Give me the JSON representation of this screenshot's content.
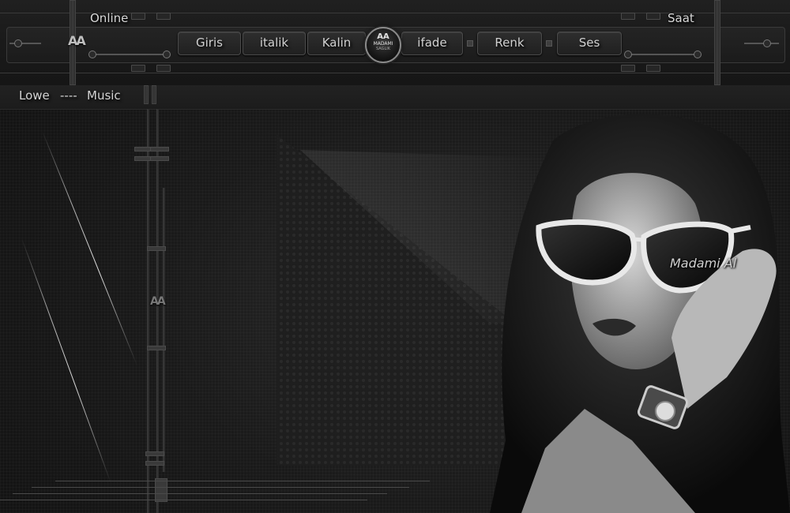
{
  "header": {
    "online_label": "Online",
    "clock_label": "Saat",
    "logo_text": "AA",
    "nav": [
      {
        "key": "giris",
        "label": "Giris"
      },
      {
        "key": "italik",
        "label": "italik"
      },
      {
        "key": "kalin",
        "label": "Kalin"
      },
      {
        "key": "ifade",
        "label": "ifade"
      },
      {
        "key": "renk",
        "label": "Renk"
      },
      {
        "key": "ses",
        "label": "Ses"
      }
    ],
    "badge": {
      "line1": "AA",
      "line2": "MADAMI",
      "line3": "SAGLIK"
    }
  },
  "music_bar": {
    "artist": "Lowe",
    "separator": "----",
    "label": "Music"
  },
  "banner": {
    "watermark": "Madami Al",
    "center_logo": "AA"
  },
  "colors": {
    "background": "#141414",
    "bar": "#1e1e1e",
    "text": "#d4d4d4"
  }
}
